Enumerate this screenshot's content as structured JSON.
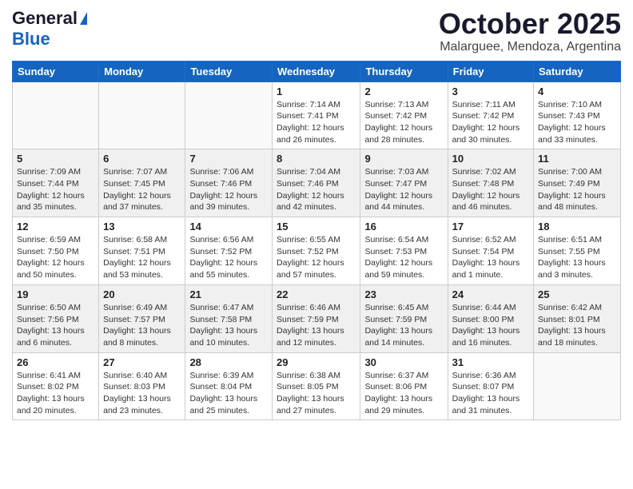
{
  "header": {
    "logo_general": "General",
    "logo_blue": "Blue",
    "month_title": "October 2025",
    "location": "Malarguee, Mendoza, Argentina"
  },
  "days_of_week": [
    "Sunday",
    "Monday",
    "Tuesday",
    "Wednesday",
    "Thursday",
    "Friday",
    "Saturday"
  ],
  "weeks": [
    [
      {
        "day": "",
        "info": ""
      },
      {
        "day": "",
        "info": ""
      },
      {
        "day": "",
        "info": ""
      },
      {
        "day": "1",
        "info": "Sunrise: 7:14 AM\nSunset: 7:41 PM\nDaylight: 12 hours\nand 26 minutes."
      },
      {
        "day": "2",
        "info": "Sunrise: 7:13 AM\nSunset: 7:42 PM\nDaylight: 12 hours\nand 28 minutes."
      },
      {
        "day": "3",
        "info": "Sunrise: 7:11 AM\nSunset: 7:42 PM\nDaylight: 12 hours\nand 30 minutes."
      },
      {
        "day": "4",
        "info": "Sunrise: 7:10 AM\nSunset: 7:43 PM\nDaylight: 12 hours\nand 33 minutes."
      }
    ],
    [
      {
        "day": "5",
        "info": "Sunrise: 7:09 AM\nSunset: 7:44 PM\nDaylight: 12 hours\nand 35 minutes."
      },
      {
        "day": "6",
        "info": "Sunrise: 7:07 AM\nSunset: 7:45 PM\nDaylight: 12 hours\nand 37 minutes."
      },
      {
        "day": "7",
        "info": "Sunrise: 7:06 AM\nSunset: 7:46 PM\nDaylight: 12 hours\nand 39 minutes."
      },
      {
        "day": "8",
        "info": "Sunrise: 7:04 AM\nSunset: 7:46 PM\nDaylight: 12 hours\nand 42 minutes."
      },
      {
        "day": "9",
        "info": "Sunrise: 7:03 AM\nSunset: 7:47 PM\nDaylight: 12 hours\nand 44 minutes."
      },
      {
        "day": "10",
        "info": "Sunrise: 7:02 AM\nSunset: 7:48 PM\nDaylight: 12 hours\nand 46 minutes."
      },
      {
        "day": "11",
        "info": "Sunrise: 7:00 AM\nSunset: 7:49 PM\nDaylight: 12 hours\nand 48 minutes."
      }
    ],
    [
      {
        "day": "12",
        "info": "Sunrise: 6:59 AM\nSunset: 7:50 PM\nDaylight: 12 hours\nand 50 minutes."
      },
      {
        "day": "13",
        "info": "Sunrise: 6:58 AM\nSunset: 7:51 PM\nDaylight: 12 hours\nand 53 minutes."
      },
      {
        "day": "14",
        "info": "Sunrise: 6:56 AM\nSunset: 7:52 PM\nDaylight: 12 hours\nand 55 minutes."
      },
      {
        "day": "15",
        "info": "Sunrise: 6:55 AM\nSunset: 7:52 PM\nDaylight: 12 hours\nand 57 minutes."
      },
      {
        "day": "16",
        "info": "Sunrise: 6:54 AM\nSunset: 7:53 PM\nDaylight: 12 hours\nand 59 minutes."
      },
      {
        "day": "17",
        "info": "Sunrise: 6:52 AM\nSunset: 7:54 PM\nDaylight: 13 hours\nand 1 minute."
      },
      {
        "day": "18",
        "info": "Sunrise: 6:51 AM\nSunset: 7:55 PM\nDaylight: 13 hours\nand 3 minutes."
      }
    ],
    [
      {
        "day": "19",
        "info": "Sunrise: 6:50 AM\nSunset: 7:56 PM\nDaylight: 13 hours\nand 6 minutes."
      },
      {
        "day": "20",
        "info": "Sunrise: 6:49 AM\nSunset: 7:57 PM\nDaylight: 13 hours\nand 8 minutes."
      },
      {
        "day": "21",
        "info": "Sunrise: 6:47 AM\nSunset: 7:58 PM\nDaylight: 13 hours\nand 10 minutes."
      },
      {
        "day": "22",
        "info": "Sunrise: 6:46 AM\nSunset: 7:59 PM\nDaylight: 13 hours\nand 12 minutes."
      },
      {
        "day": "23",
        "info": "Sunrise: 6:45 AM\nSunset: 7:59 PM\nDaylight: 13 hours\nand 14 minutes."
      },
      {
        "day": "24",
        "info": "Sunrise: 6:44 AM\nSunset: 8:00 PM\nDaylight: 13 hours\nand 16 minutes."
      },
      {
        "day": "25",
        "info": "Sunrise: 6:42 AM\nSunset: 8:01 PM\nDaylight: 13 hours\nand 18 minutes."
      }
    ],
    [
      {
        "day": "26",
        "info": "Sunrise: 6:41 AM\nSunset: 8:02 PM\nDaylight: 13 hours\nand 20 minutes."
      },
      {
        "day": "27",
        "info": "Sunrise: 6:40 AM\nSunset: 8:03 PM\nDaylight: 13 hours\nand 23 minutes."
      },
      {
        "day": "28",
        "info": "Sunrise: 6:39 AM\nSunset: 8:04 PM\nDaylight: 13 hours\nand 25 minutes."
      },
      {
        "day": "29",
        "info": "Sunrise: 6:38 AM\nSunset: 8:05 PM\nDaylight: 13 hours\nand 27 minutes."
      },
      {
        "day": "30",
        "info": "Sunrise: 6:37 AM\nSunset: 8:06 PM\nDaylight: 13 hours\nand 29 minutes."
      },
      {
        "day": "31",
        "info": "Sunrise: 6:36 AM\nSunset: 8:07 PM\nDaylight: 13 hours\nand 31 minutes."
      },
      {
        "day": "",
        "info": ""
      }
    ]
  ]
}
